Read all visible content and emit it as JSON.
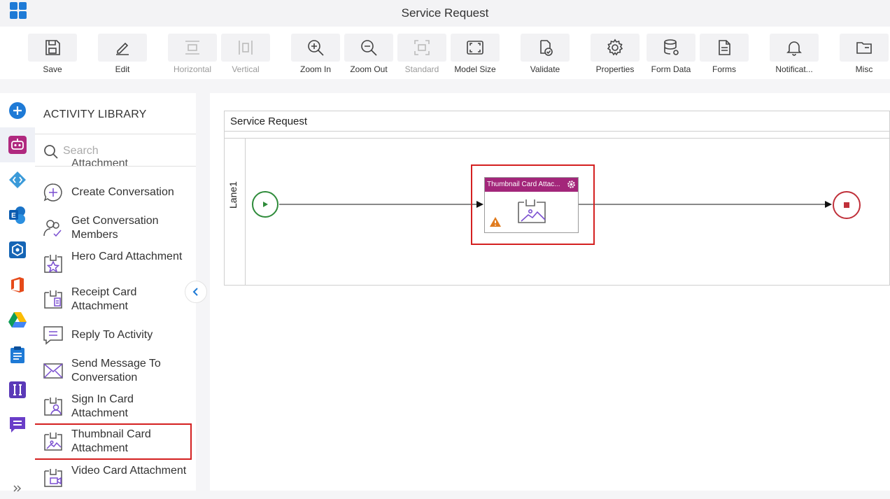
{
  "window": {
    "title": "Service Request"
  },
  "toolbar": {
    "buttons": [
      {
        "label": "Save",
        "icon": "save-icon",
        "enabled": true
      },
      {
        "label": "Edit",
        "icon": "edit-icon",
        "enabled": true
      },
      {
        "label": "Horizontal",
        "icon": "horizontal-icon",
        "enabled": false
      },
      {
        "label": "Vertical",
        "icon": "vertical-icon",
        "enabled": false
      },
      {
        "label": "Zoom In",
        "icon": "zoom-in-icon",
        "enabled": true
      },
      {
        "label": "Zoom Out",
        "icon": "zoom-out-icon",
        "enabled": true
      },
      {
        "label": "Standard",
        "icon": "standard-icon",
        "enabled": false
      },
      {
        "label": "Model Size",
        "icon": "model-size-icon",
        "enabled": true
      },
      {
        "label": "Validate",
        "icon": "validate-icon",
        "enabled": true
      },
      {
        "label": "Properties",
        "icon": "gear-icon",
        "enabled": true
      },
      {
        "label": "Form Data",
        "icon": "database-icon",
        "enabled": true
      },
      {
        "label": "Forms",
        "icon": "forms-icon",
        "enabled": true
      },
      {
        "label": "Notificat...",
        "icon": "bell-icon",
        "enabled": true
      },
      {
        "label": "Misc",
        "icon": "folder-icon",
        "enabled": true
      }
    ]
  },
  "left_rail": {
    "icons": [
      "add-icon",
      "bot-icon",
      "azure-devops-icon",
      "exchange-icon",
      "box-icon",
      "office-icon",
      "google-drive-icon",
      "clipboard-icon",
      "integration-icon",
      "chat-icon",
      "expand-icon"
    ]
  },
  "library": {
    "title": "ACTIVITY LIBRARY",
    "search_placeholder": "Search",
    "cut_item": "Attachment",
    "items": [
      {
        "label": "Create Conversation",
        "icon": "create-conversation-icon"
      },
      {
        "label": "Get Conversation Members",
        "icon": "conversation-members-icon"
      },
      {
        "label": "Hero Card Attachment",
        "icon": "hero-card-icon"
      },
      {
        "label": "Receipt Card Attachment",
        "icon": "receipt-card-icon"
      },
      {
        "label": "Reply To Activity",
        "icon": "reply-icon"
      },
      {
        "label": "Send Message To Conversation",
        "icon": "send-message-icon"
      },
      {
        "label": "Sign In Card Attachment",
        "icon": "sign-in-card-icon"
      },
      {
        "label": "Thumbnail Card Attachment",
        "icon": "thumbnail-card-icon",
        "selected": true
      },
      {
        "label": "Video Card Attachment",
        "icon": "video-card-icon"
      }
    ]
  },
  "canvas": {
    "pool_title": "Service Request",
    "lane_label": "Lane1",
    "task": {
      "title": "Thumbnail Card Attac...",
      "header_color": "#a3267a",
      "has_warning": true
    },
    "colors": {
      "start": "#2e8b3a",
      "end": "#c0303a",
      "selection": "#d42020"
    }
  }
}
